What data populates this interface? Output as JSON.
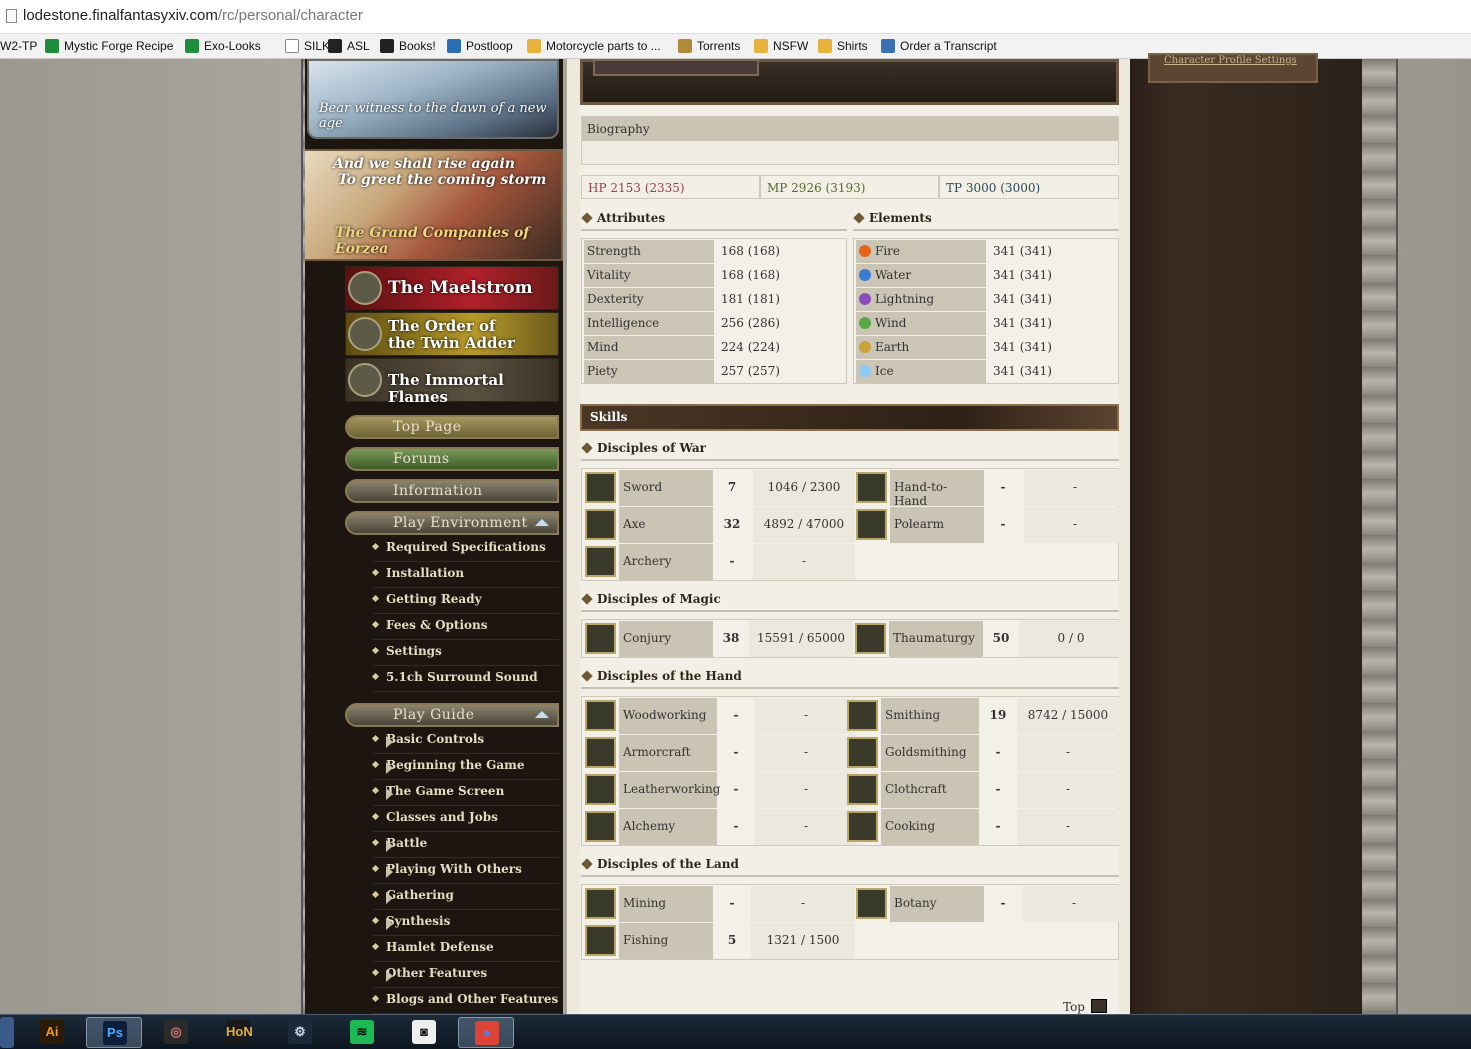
{
  "browser": {
    "url_host": "lodestone.finalfantasyxiv.com",
    "url_path": "/rc/personal/character",
    "bookmarks": [
      {
        "label": "W2-TP",
        "icon": "none"
      },
      {
        "label": "Mystic Forge Recipe",
        "icon": "sheet-icon"
      },
      {
        "label": "Exo-Looks",
        "icon": "sheet-icon"
      },
      {
        "label": "SILK",
        "icon": "doc-icon"
      },
      {
        "label": "ASL",
        "icon": "asl-icon"
      },
      {
        "label": "Books!",
        "icon": "steam-icon"
      },
      {
        "label": "Postloop",
        "icon": "postloop-icon"
      },
      {
        "label": "Motorcycle parts to ...",
        "icon": "folder-icon"
      },
      {
        "label": "Torrents",
        "icon": "shield-icon"
      },
      {
        "label": "NSFW",
        "icon": "folder-icon"
      },
      {
        "label": "Shirts",
        "icon": "folder-icon"
      },
      {
        "label": "Order a Transcript",
        "icon": "gear-icon"
      }
    ]
  },
  "leftnav": {
    "banner1": "Bear witness to the dawn of a new age",
    "banner2_line1": "And we shall rise again",
    "banner2_line2": "To greet the coming storm",
    "banner2_title": "The Grand Companies of Eorzea",
    "companies": [
      "The Maelstrom",
      "The Order of the Twin Adder",
      "The Immortal Flames"
    ],
    "tabs": {
      "top": "Top Page",
      "forums": "Forums",
      "information": "Information",
      "play_env": "Play Environment",
      "play_guide": "Play Guide"
    },
    "play_env_items": [
      "Required Specifications",
      "Installation",
      "Getting Ready",
      "Fees & Options",
      "Settings",
      "5.1ch Surround Sound"
    ],
    "play_guide_items": [
      "Basic Controls",
      "Beginning the Game",
      "The Game Screen",
      "Classes and Jobs",
      "Battle",
      "Playing With Others",
      "Gathering",
      "Synthesis",
      "Hamlet Defense",
      "Other Features",
      "Blogs and Other Features"
    ]
  },
  "rightcol": {
    "link": "Character Profile Settings"
  },
  "profile": {
    "biography_label": "Biography",
    "hp": "HP 2153 (2335)",
    "mp": "MP 2926 (3193)",
    "tp": "TP 3000 (3000)",
    "colors": {
      "hp": "#e9c9cc",
      "mp": "#dde6c4",
      "tp": "#c9dfe6"
    },
    "attributes_title": "Attributes",
    "attributes": [
      {
        "k": "Strength",
        "v": "168 (168)"
      },
      {
        "k": "Vitality",
        "v": "168 (168)"
      },
      {
        "k": "Dexterity",
        "v": "181 (181)"
      },
      {
        "k": "Intelligence",
        "v": "256 (286)"
      },
      {
        "k": "Mind",
        "v": "224 (224)"
      },
      {
        "k": "Piety",
        "v": "257 (257)"
      }
    ],
    "elements_title": "Elements",
    "elements": [
      {
        "k": "Fire",
        "v": "341 (341)",
        "icon": "fire-icon",
        "color": "#e8621a"
      },
      {
        "k": "Water",
        "v": "341 (341)",
        "icon": "water-icon",
        "color": "#3a7bd5"
      },
      {
        "k": "Lightning",
        "v": "341 (341)",
        "icon": "lightning-icon",
        "color": "#8a4bbd"
      },
      {
        "k": "Wind",
        "v": "341 (341)",
        "icon": "wind-icon",
        "color": "#5aa845"
      },
      {
        "k": "Earth",
        "v": "341 (341)",
        "icon": "earth-icon",
        "color": "#c9a23a"
      },
      {
        "k": "Ice",
        "v": "341 (341)",
        "icon": "ice-icon",
        "color": "#8ec9f0"
      }
    ]
  },
  "skills": {
    "title": "Skills",
    "war_title": "Disciples of War",
    "war": [
      {
        "name": "Sword",
        "lvl": "7",
        "exp": "1046 / 2300",
        "icon": "sword-icon"
      },
      {
        "name": "Hand-to-Hand",
        "lvl": "-",
        "exp": "-",
        "icon": "fist-icon"
      },
      {
        "name": "Axe",
        "lvl": "32",
        "exp": "4892 / 47000",
        "icon": "axe-icon"
      },
      {
        "name": "Polearm",
        "lvl": "-",
        "exp": "-",
        "icon": "polearm-icon"
      },
      {
        "name": "Archery",
        "lvl": "-",
        "exp": "-",
        "icon": "bow-icon"
      }
    ],
    "magic_title": "Disciples of Magic",
    "magic": [
      {
        "name": "Conjury",
        "lvl": "38",
        "exp": "15591 / 65000",
        "icon": "conjury-icon"
      },
      {
        "name": "Thaumaturgy",
        "lvl": "50",
        "exp": "0 / 0",
        "icon": "thaumaturgy-icon"
      }
    ],
    "hand_title": "Disciples of the Hand",
    "hand": [
      {
        "name": "Woodworking",
        "lvl": "-",
        "exp": "-",
        "icon": "woodworking-icon"
      },
      {
        "name": "Smithing",
        "lvl": "19",
        "exp": "8742 / 15000",
        "icon": "smithing-icon"
      },
      {
        "name": "Armorcraft",
        "lvl": "-",
        "exp": "-",
        "icon": "armorcraft-icon"
      },
      {
        "name": "Goldsmithing",
        "lvl": "-",
        "exp": "-",
        "icon": "goldsmithing-icon"
      },
      {
        "name": "Leatherworking",
        "lvl": "-",
        "exp": "-",
        "icon": "leatherworking-icon"
      },
      {
        "name": "Clothcraft",
        "lvl": "-",
        "exp": "-",
        "icon": "clothcraft-icon"
      },
      {
        "name": "Alchemy",
        "lvl": "-",
        "exp": "-",
        "icon": "alchemy-icon"
      },
      {
        "name": "Cooking",
        "lvl": "-",
        "exp": "-",
        "icon": "cooking-icon"
      }
    ],
    "land_title": "Disciples of the Land",
    "land": [
      {
        "name": "Mining",
        "lvl": "-",
        "exp": "-",
        "icon": "mining-icon"
      },
      {
        "name": "Botany",
        "lvl": "-",
        "exp": "-",
        "icon": "botany-icon"
      },
      {
        "name": "Fishing",
        "lvl": "5",
        "exp": "1321 / 1500",
        "icon": "fishing-icon"
      }
    ]
  },
  "footer": {
    "top": "Top"
  },
  "taskbar": {
    "apps": [
      {
        "name": "illustrator-icon",
        "glyph": "Ai",
        "bg": "#2b1a05",
        "fg": "#f29a1f"
      },
      {
        "name": "photoshop-icon",
        "glyph": "Ps",
        "bg": "#0b1f3a",
        "fg": "#4aa8ff"
      },
      {
        "name": "ffxiv-icon",
        "glyph": "◎",
        "bg": "#2a2a2a",
        "fg": "#d07a7a"
      },
      {
        "name": "hon-icon",
        "glyph": "HoN",
        "bg": "#1a1a1a",
        "fg": "#e0b040"
      },
      {
        "name": "steam-icon",
        "glyph": "⚙",
        "bg": "#1a2a3a",
        "fg": "#c8d8e8"
      },
      {
        "name": "spotify-icon",
        "glyph": "≋",
        "bg": "#1db954",
        "fg": "#0a0a0a"
      },
      {
        "name": "app-icon",
        "glyph": "◙",
        "bg": "#eeeeee",
        "fg": "#111111"
      },
      {
        "name": "chrome-icon",
        "glyph": "●",
        "bg": "#db4437",
        "fg": "#4285f4"
      }
    ]
  }
}
